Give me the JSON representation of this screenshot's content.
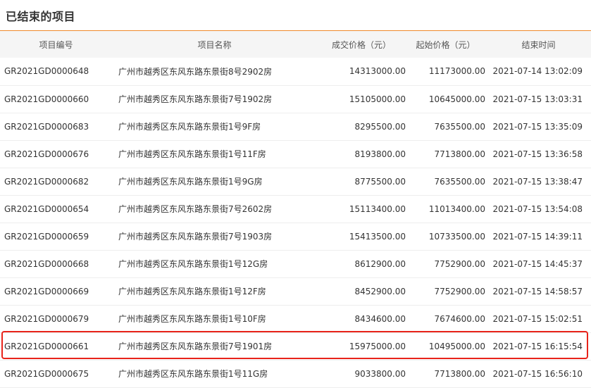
{
  "page": {
    "title": "已结束的项目",
    "accent_color": "#ef8a2b",
    "highlight_color": "#e8231a"
  },
  "table": {
    "headers": {
      "code": "项目编号",
      "name": "项目名称",
      "deal_price": "成交价格（元）",
      "start_price": "起始价格（元）",
      "end_time": "结束时间"
    },
    "rows": [
      {
        "code": "GR2021GD0000648",
        "name": "广州市越秀区东风东路东景街8号2902房",
        "deal_price": "14313000.00",
        "start_price": "11173000.00",
        "end_time": "2021-07-14 13:02:09"
      },
      {
        "code": "GR2021GD0000660",
        "name": "广州市越秀区东风东路东景街7号1902房",
        "deal_price": "15105000.00",
        "start_price": "10645000.00",
        "end_time": "2021-07-15 13:03:31"
      },
      {
        "code": "GR2021GD0000683",
        "name": "广州市越秀区东风东路东景街1号9F房",
        "deal_price": "8295500.00",
        "start_price": "7635500.00",
        "end_time": "2021-07-15 13:35:09"
      },
      {
        "code": "GR2021GD0000676",
        "name": "广州市越秀区东风东路东景街1号11F房",
        "deal_price": "8193800.00",
        "start_price": "7713800.00",
        "end_time": "2021-07-15 13:36:58"
      },
      {
        "code": "GR2021GD0000682",
        "name": "广州市越秀区东风东路东景街1号9G房",
        "deal_price": "8775500.00",
        "start_price": "7635500.00",
        "end_time": "2021-07-15 13:38:47"
      },
      {
        "code": "GR2021GD0000654",
        "name": "广州市越秀区东风东路东景街7号2602房",
        "deal_price": "15113400.00",
        "start_price": "11013400.00",
        "end_time": "2021-07-15 13:54:08"
      },
      {
        "code": "GR2021GD0000659",
        "name": "广州市越秀区东风东路东景街7号1903房",
        "deal_price": "15413500.00",
        "start_price": "10733500.00",
        "end_time": "2021-07-15 14:39:11"
      },
      {
        "code": "GR2021GD0000668",
        "name": "广州市越秀区东风东路东景街1号12G房",
        "deal_price": "8612900.00",
        "start_price": "7752900.00",
        "end_time": "2021-07-15 14:45:37"
      },
      {
        "code": "GR2021GD0000669",
        "name": "广州市越秀区东风东路东景街1号12F房",
        "deal_price": "8452900.00",
        "start_price": "7752900.00",
        "end_time": "2021-07-15 14:58:57"
      },
      {
        "code": "GR2021GD0000679",
        "name": "广州市越秀区东风东路东景街1号10F房",
        "deal_price": "8434600.00",
        "start_price": "7674600.00",
        "end_time": "2021-07-15 15:02:51"
      },
      {
        "code": "GR2021GD0000661",
        "name": "广州市越秀区东风东路东景街7号1901房",
        "deal_price": "15975000.00",
        "start_price": "10495000.00",
        "end_time": "2021-07-15 16:15:54",
        "highlighted": true
      },
      {
        "code": "GR2021GD0000675",
        "name": "广州市越秀区东风东路东景街1号11G房",
        "deal_price": "9033800.00",
        "start_price": "7713800.00",
        "end_time": "2021-07-15 16:56:10"
      }
    ]
  }
}
